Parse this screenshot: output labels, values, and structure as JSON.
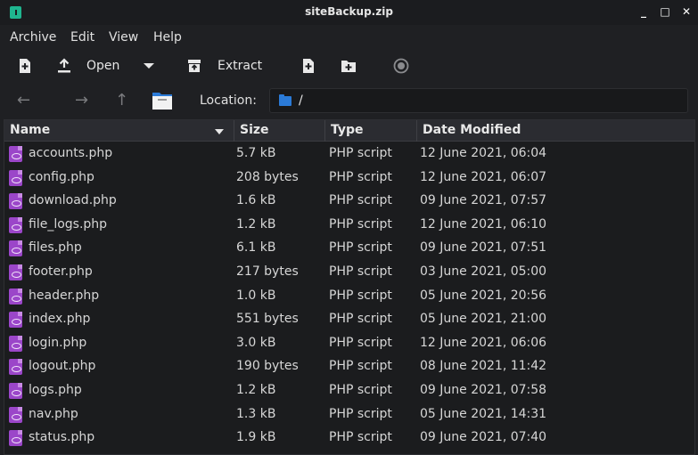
{
  "window": {
    "title": "siteBackup.zip",
    "controls": [
      "_",
      "□",
      "✕"
    ]
  },
  "menu": [
    "Archive",
    "Edit",
    "View",
    "Help"
  ],
  "toolbar": {
    "open_label": "Open",
    "extract_label": "Extract"
  },
  "location": {
    "label": "Location:",
    "value": "/"
  },
  "columns": {
    "name": "Name",
    "size": "Size",
    "type": "Type",
    "date": "Date Modified"
  },
  "files": [
    {
      "name": "accounts.php",
      "size": "5.7 kB",
      "type": "PHP script",
      "date": "12 June 2021, 06:04"
    },
    {
      "name": "config.php",
      "size": "208 bytes",
      "type": "PHP script",
      "date": "12 June 2021, 06:07"
    },
    {
      "name": "download.php",
      "size": "1.6 kB",
      "type": "PHP script",
      "date": "09 June 2021, 07:57"
    },
    {
      "name": "file_logs.php",
      "size": "1.2 kB",
      "type": "PHP script",
      "date": "12 June 2021, 06:10"
    },
    {
      "name": "files.php",
      "size": "6.1 kB",
      "type": "PHP script",
      "date": "09 June 2021, 07:51"
    },
    {
      "name": "footer.php",
      "size": "217 bytes",
      "type": "PHP script",
      "date": "03 June 2021, 05:00"
    },
    {
      "name": "header.php",
      "size": "1.0 kB",
      "type": "PHP script",
      "date": "05 June 2021, 20:56"
    },
    {
      "name": "index.php",
      "size": "551 bytes",
      "type": "PHP script",
      "date": "05 June 2021, 21:00"
    },
    {
      "name": "login.php",
      "size": "3.0 kB",
      "type": "PHP script",
      "date": "12 June 2021, 06:06"
    },
    {
      "name": "logout.php",
      "size": "190 bytes",
      "type": "PHP script",
      "date": "08 June 2021, 11:42"
    },
    {
      "name": "logs.php",
      "size": "1.2 kB",
      "type": "PHP script",
      "date": "09 June 2021, 07:58"
    },
    {
      "name": "nav.php",
      "size": "1.3 kB",
      "type": "PHP script",
      "date": "05 June 2021, 14:31"
    },
    {
      "name": "status.php",
      "size": "1.9 kB",
      "type": "PHP script",
      "date": "09 June 2021, 07:40"
    }
  ],
  "colors": {
    "accent": "#2b7bd8",
    "app_icon": "#1fb58f",
    "php_icon": "#9b46c9"
  }
}
